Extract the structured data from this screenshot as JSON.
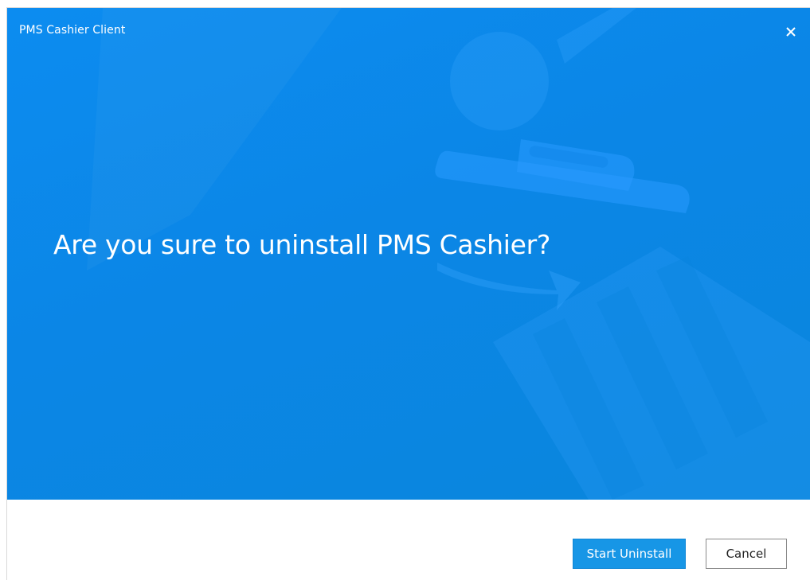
{
  "window": {
    "title": "PMS Cashier Client",
    "close_icon": "close-icon"
  },
  "hero": {
    "message": "Are you sure to uninstall PMS Cashier?",
    "illustration_icon": "trash-bin-icon"
  },
  "footer": {
    "start_label": "Start Uninstall",
    "cancel_label": "Cancel"
  },
  "colors": {
    "hero_background": "#0b88e6",
    "primary_button": "#1796e6",
    "text_on_primary": "#ffffff"
  }
}
